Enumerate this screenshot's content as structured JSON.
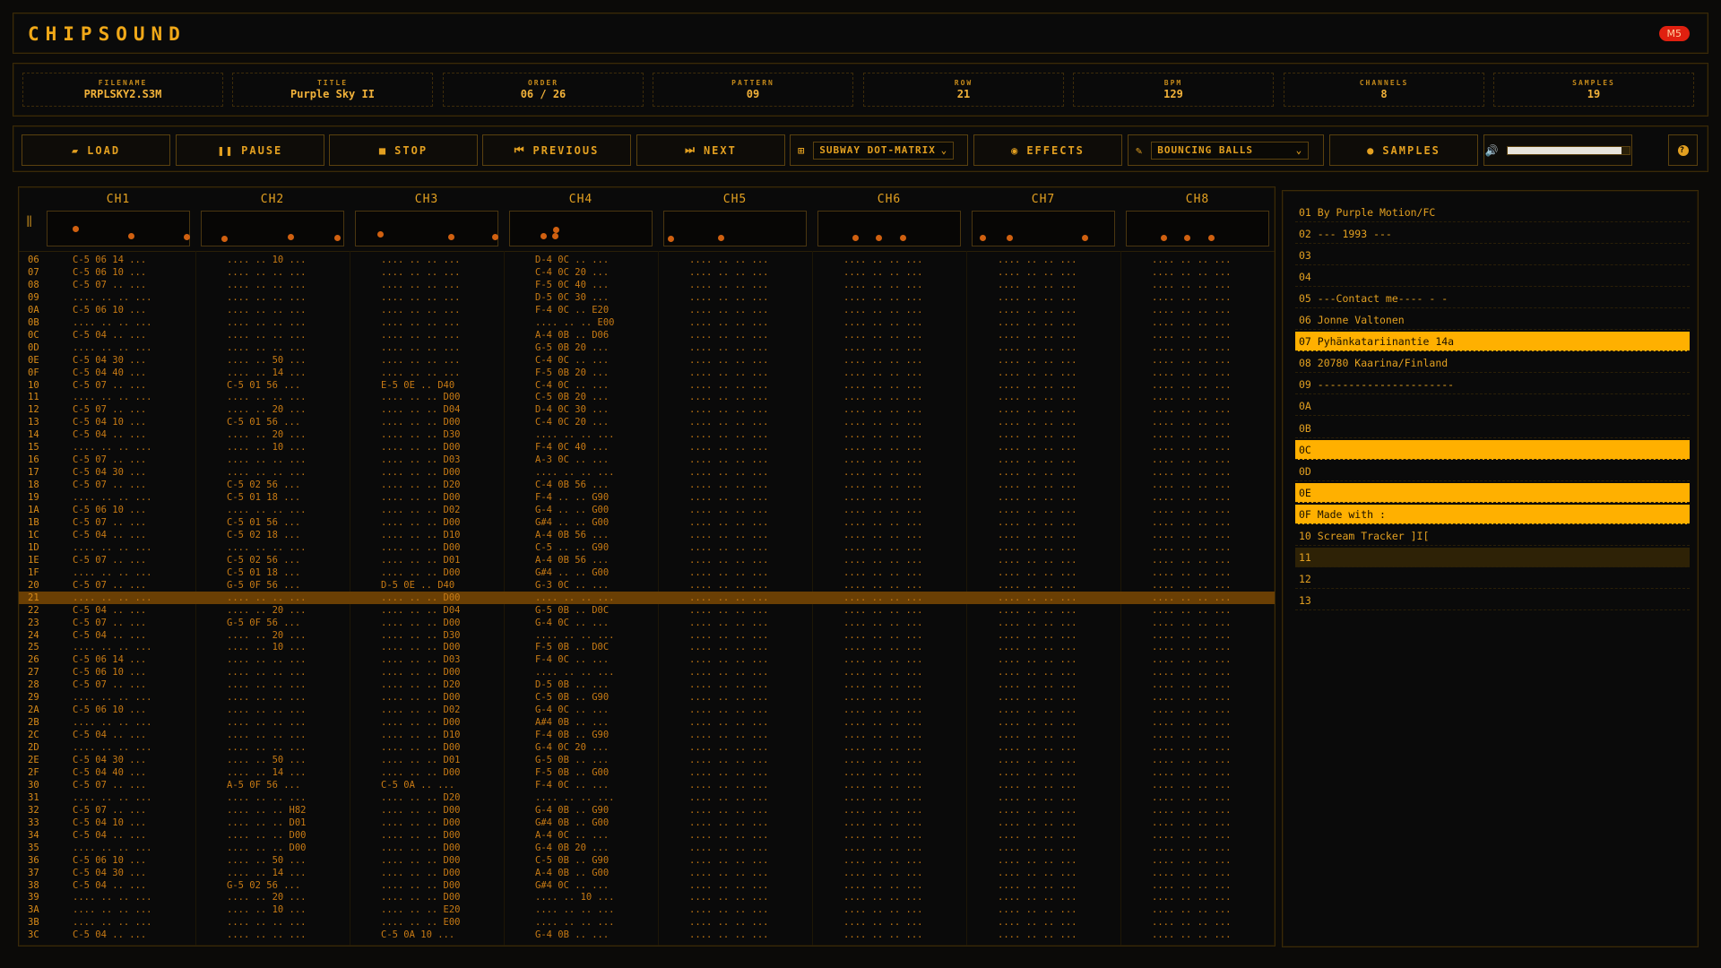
{
  "app": {
    "title": "CHIPSOUND",
    "badge": "M5"
  },
  "info": [
    {
      "label": "FILENAME",
      "value": "PRPLSKY2.S3M"
    },
    {
      "label": "TITLE",
      "value": "Purple Sky II"
    },
    {
      "label": "ORDER",
      "value": "06 / 26"
    },
    {
      "label": "PATTERN",
      "value": "09"
    },
    {
      "label": "ROW",
      "value": "21"
    },
    {
      "label": "BPM",
      "value": "129"
    },
    {
      "label": "CHANNELS",
      "value": "8"
    },
    {
      "label": "SAMPLES",
      "value": "19"
    }
  ],
  "toolbar": {
    "load": "LOAD",
    "pause": "PAUSE",
    "stop": "STOP",
    "previous": "PREVIOUS",
    "next": "NEXT",
    "display_mode": "SUBWAY DOT-MATRIX",
    "effects": "EFFECTS",
    "visualizer": "BOUNCING BALLS",
    "samples": "SAMPLES",
    "volume": 0.93,
    "help": "?"
  },
  "channels": [
    "CH1",
    "CH2",
    "CH3",
    "CH4",
    "CH5",
    "CH6",
    "CH7",
    "CH8"
  ],
  "current_row": "21",
  "rows": [
    [
      "06",
      "C-5 06 14 ...",
      ".... .. 10 ...",
      ".... .. .. ...",
      "D-4 0C .. ...",
      ".... .. .. ...",
      ".... .. .. ...",
      ".... .. .. ...",
      ".... .. .. ..."
    ],
    [
      "07",
      "C-5 06 10 ...",
      ".... .. .. ...",
      ".... .. .. ...",
      "C-4 0C 20 ...",
      ".... .. .. ...",
      ".... .. .. ...",
      ".... .. .. ...",
      ".... .. .. ..."
    ],
    [
      "08",
      "C-5 07 .. ...",
      ".... .. .. ...",
      ".... .. .. ...",
      "F-5 0C 40 ...",
      ".... .. .. ...",
      ".... .. .. ...",
      ".... .. .. ...",
      ".... .. .. ..."
    ],
    [
      "09",
      ".... .. .. ...",
      ".... .. .. ...",
      ".... .. .. ...",
      "D-5 0C 30 ...",
      ".... .. .. ...",
      ".... .. .. ...",
      ".... .. .. ...",
      ".... .. .. ..."
    ],
    [
      "0A",
      "C-5 06 10 ...",
      ".... .. .. ...",
      ".... .. .. ...",
      "F-4 0C .. E20",
      ".... .. .. ...",
      ".... .. .. ...",
      ".... .. .. ...",
      ".... .. .. ..."
    ],
    [
      "0B",
      ".... .. .. ...",
      ".... .. .. ...",
      ".... .. .. ...",
      ".... .. .. E00",
      ".... .. .. ...",
      ".... .. .. ...",
      ".... .. .. ...",
      ".... .. .. ..."
    ],
    [
      "0C",
      "C-5 04 .. ...",
      ".... .. .. ...",
      ".... .. .. ...",
      "A-4 0B .. D06",
      ".... .. .. ...",
      ".... .. .. ...",
      ".... .. .. ...",
      ".... .. .. ..."
    ],
    [
      "0D",
      ".... .. .. ...",
      ".... .. .. ...",
      ".... .. .. ...",
      "G-5 0B 20 ...",
      ".... .. .. ...",
      ".... .. .. ...",
      ".... .. .. ...",
      ".... .. .. ..."
    ],
    [
      "0E",
      "C-5 04 30 ...",
      ".... .. 50 ...",
      ".... .. .. ...",
      "C-4 0C .. ...",
      ".... .. .. ...",
      ".... .. .. ...",
      ".... .. .. ...",
      ".... .. .. ..."
    ],
    [
      "0F",
      "C-5 04 40 ...",
      ".... .. 14 ...",
      ".... .. .. ...",
      "F-5 0B 20 ...",
      ".... .. .. ...",
      ".... .. .. ...",
      ".... .. .. ...",
      ".... .. .. ..."
    ],
    [
      "10",
      "C-5 07 .. ...",
      "C-5 01 56 ...",
      "E-5 0E .. D40",
      "C-4 0C .. ...",
      ".... .. .. ...",
      ".... .. .. ...",
      ".... .. .. ...",
      ".... .. .. ..."
    ],
    [
      "11",
      ".... .. .. ...",
      ".... .. .. ...",
      ".... .. .. D00",
      "C-5 0B 20 ...",
      ".... .. .. ...",
      ".... .. .. ...",
      ".... .. .. ...",
      ".... .. .. ..."
    ],
    [
      "12",
      "C-5 07 .. ...",
      ".... .. 20 ...",
      ".... .. .. D04",
      "D-4 0C 30 ...",
      ".... .. .. ...",
      ".... .. .. ...",
      ".... .. .. ...",
      ".... .. .. ..."
    ],
    [
      "13",
      "C-5 04 10 ...",
      "C-5 01 56 ...",
      ".... .. .. D00",
      "C-4 0C 20 ...",
      ".... .. .. ...",
      ".... .. .. ...",
      ".... .. .. ...",
      ".... .. .. ..."
    ],
    [
      "14",
      "C-5 04 .. ...",
      ".... .. 20 ...",
      ".... .. .. D30",
      ".... .. .. ...",
      ".... .. .. ...",
      ".... .. .. ...",
      ".... .. .. ...",
      ".... .. .. ..."
    ],
    [
      "15",
      ".... .. .. ...",
      ".... .. 10 ...",
      ".... .. .. D00",
      "F-4 0C 40 ...",
      ".... .. .. ...",
      ".... .. .. ...",
      ".... .. .. ...",
      ".... .. .. ..."
    ],
    [
      "16",
      "C-5 07 .. ...",
      ".... .. .. ...",
      ".... .. .. D03",
      "A-3 0C .. ...",
      ".... .. .. ...",
      ".... .. .. ...",
      ".... .. .. ...",
      ".... .. .. ..."
    ],
    [
      "17",
      "C-5 04 30 ...",
      ".... .. .. ...",
      ".... .. .. D00",
      ".... .. .. ...",
      ".... .. .. ...",
      ".... .. .. ...",
      ".... .. .. ...",
      ".... .. .. ..."
    ],
    [
      "18",
      "C-5 07 .. ...",
      "C-5 02 56 ...",
      ".... .. .. D20",
      "C-4 0B 56 ...",
      ".... .. .. ...",
      ".... .. .. ...",
      ".... .. .. ...",
      ".... .. .. ..."
    ],
    [
      "19",
      ".... .. .. ...",
      "C-5 01 18 ...",
      ".... .. .. D00",
      "F-4 .. .. G90",
      ".... .. .. ...",
      ".... .. .. ...",
      ".... .. .. ...",
      ".... .. .. ..."
    ],
    [
      "1A",
      "C-5 06 10 ...",
      ".... .. .. ...",
      ".... .. .. D02",
      "G-4 .. .. G00",
      ".... .. .. ...",
      ".... .. .. ...",
      ".... .. .. ...",
      ".... .. .. ..."
    ],
    [
      "1B",
      "C-5 07 .. ...",
      "C-5 01 56 ...",
      ".... .. .. D00",
      "G#4 .. .. G00",
      ".... .. .. ...",
      ".... .. .. ...",
      ".... .. .. ...",
      ".... .. .. ..."
    ],
    [
      "1C",
      "C-5 04 .. ...",
      "C-5 02 18 ...",
      ".... .. .. D10",
      "A-4 0B 56 ...",
      ".... .. .. ...",
      ".... .. .. ...",
      ".... .. .. ...",
      ".... .. .. ..."
    ],
    [
      "1D",
      ".... .. .. ...",
      ".... .. .. ...",
      ".... .. .. D00",
      "C-5 .. .. G90",
      ".... .. .. ...",
      ".... .. .. ...",
      ".... .. .. ...",
      ".... .. .. ..."
    ],
    [
      "1E",
      "C-5 07 .. ...",
      "C-5 02 56 ...",
      ".... .. .. D01",
      "A-4 0B 56 ...",
      ".... .. .. ...",
      ".... .. .. ...",
      ".... .. .. ...",
      ".... .. .. ..."
    ],
    [
      "1F",
      ".... .. .. ...",
      "C-5 01 18 ...",
      ".... .. .. D00",
      "G#4 .. .. G00",
      ".... .. .. ...",
      ".... .. .. ...",
      ".... .. .. ...",
      ".... .. .. ..."
    ],
    [
      "20",
      "C-5 07 .. ...",
      "G-5 0F 56 ...",
      "D-5 0E .. D40",
      "G-3 0C .. ...",
      ".... .. .. ...",
      ".... .. .. ...",
      ".... .. .. ...",
      ".... .. .. ..."
    ],
    [
      "21",
      ".... .. .. ...",
      ".... .. .. ...",
      ".... .. .. D00",
      ".... .. .. ...",
      ".... .. .. ...",
      ".... .. .. ...",
      ".... .. .. ...",
      ".... .. .. ..."
    ],
    [
      "22",
      "C-5 04 .. ...",
      ".... .. 20 ...",
      ".... .. .. D04",
      "G-5 0B .. D0C",
      ".... .. .. ...",
      ".... .. .. ...",
      ".... .. .. ...",
      ".... .. .. ..."
    ],
    [
      "23",
      "C-5 07 .. ...",
      "G-5 0F 56 ...",
      ".... .. .. D00",
      "G-4 0C .. ...",
      ".... .. .. ...",
      ".... .. .. ...",
      ".... .. .. ...",
      ".... .. .. ..."
    ],
    [
      "24",
      "C-5 04 .. ...",
      ".... .. 20 ...",
      ".... .. .. D30",
      ".... .. .. ...",
      ".... .. .. ...",
      ".... .. .. ...",
      ".... .. .. ...",
      ".... .. .. ..."
    ],
    [
      "25",
      ".... .. .. ...",
      ".... .. 10 ...",
      ".... .. .. D00",
      "F-5 0B .. D0C",
      ".... .. .. ...",
      ".... .. .. ...",
      ".... .. .. ...",
      ".... .. .. ..."
    ],
    [
      "26",
      "C-5 06 14 ...",
      ".... .. .. ...",
      ".... .. .. D03",
      "F-4 0C .. ...",
      ".... .. .. ...",
      ".... .. .. ...",
      ".... .. .. ...",
      ".... .. .. ..."
    ],
    [
      "27",
      "C-5 06 10 ...",
      ".... .. .. ...",
      ".... .. .. D00",
      ".... .. .. ...",
      ".... .. .. ...",
      ".... .. .. ...",
      ".... .. .. ...",
      ".... .. .. ..."
    ],
    [
      "28",
      "C-5 07 .. ...",
      ".... .. .. ...",
      ".... .. .. D20",
      "D-5 0B .. ...",
      ".... .. .. ...",
      ".... .. .. ...",
      ".... .. .. ...",
      ".... .. .. ..."
    ],
    [
      "29",
      ".... .. .. ...",
      ".... .. .. ...",
      ".... .. .. D00",
      "C-5 0B .. G90",
      ".... .. .. ...",
      ".... .. .. ...",
      ".... .. .. ...",
      ".... .. .. ..."
    ],
    [
      "2A",
      "C-5 06 10 ...",
      ".... .. .. ...",
      ".... .. .. D02",
      "G-4 0C .. ...",
      ".... .. .. ...",
      ".... .. .. ...",
      ".... .. .. ...",
      ".... .. .. ..."
    ],
    [
      "2B",
      ".... .. .. ...",
      ".... .. .. ...",
      ".... .. .. D00",
      "A#4 0B .. ...",
      ".... .. .. ...",
      ".... .. .. ...",
      ".... .. .. ...",
      ".... .. .. ..."
    ],
    [
      "2C",
      "C-5 04 .. ...",
      ".... .. .. ...",
      ".... .. .. D10",
      "F-4 0B .. G90",
      ".... .. .. ...",
      ".... .. .. ...",
      ".... .. .. ...",
      ".... .. .. ..."
    ],
    [
      "2D",
      ".... .. .. ...",
      ".... .. .. ...",
      ".... .. .. D00",
      "G-4 0C 20 ...",
      ".... .. .. ...",
      ".... .. .. ...",
      ".... .. .. ...",
      ".... .. .. ..."
    ],
    [
      "2E",
      "C-5 04 30 ...",
      ".... .. 50 ...",
      ".... .. .. D01",
      "G-5 0B .. ...",
      ".... .. .. ...",
      ".... .. .. ...",
      ".... .. .. ...",
      ".... .. .. ..."
    ],
    [
      "2F",
      "C-5 04 40 ...",
      ".... .. 14 ...",
      ".... .. .. D00",
      "F-5 0B .. G00",
      ".... .. .. ...",
      ".... .. .. ...",
      ".... .. .. ...",
      ".... .. .. ..."
    ],
    [
      "30",
      "C-5 07 .. ...",
      "A-5 0F 56 ...",
      "C-5 0A .. ...",
      "F-4 0C .. ...",
      ".... .. .. ...",
      ".... .. .. ...",
      ".... .. .. ...",
      ".... .. .. ..."
    ],
    [
      "31",
      ".... .. .. ...",
      ".... .. .. ...",
      ".... .. .. D20",
      ".... .. .. ...",
      ".... .. .. ...",
      ".... .. .. ...",
      ".... .. .. ...",
      ".... .. .. ..."
    ],
    [
      "32",
      "C-5 07 .. ...",
      ".... .. .. H82",
      ".... .. .. D00",
      "G-4 0B .. G90",
      ".... .. .. ...",
      ".... .. .. ...",
      ".... .. .. ...",
      ".... .. .. ..."
    ],
    [
      "33",
      "C-5 04 10 ...",
      ".... .. .. D01",
      ".... .. .. D00",
      "G#4 0B .. G00",
      ".... .. .. ...",
      ".... .. .. ...",
      ".... .. .. ...",
      ".... .. .. ..."
    ],
    [
      "34",
      "C-5 04 .. ...",
      ".... .. .. D00",
      ".... .. .. D00",
      "A-4 0C .. ...",
      ".... .. .. ...",
      ".... .. .. ...",
      ".... .. .. ...",
      ".... .. .. ..."
    ],
    [
      "35",
      ".... .. .. ...",
      ".... .. .. D00",
      ".... .. .. D00",
      "G-4 0B 20 ...",
      ".... .. .. ...",
      ".... .. .. ...",
      ".... .. .. ...",
      ".... .. .. ..."
    ],
    [
      "36",
      "C-5 06 10 ...",
      ".... .. 50 ...",
      ".... .. .. D00",
      "C-5 0B .. G90",
      ".... .. .. ...",
      ".... .. .. ...",
      ".... .. .. ...",
      ".... .. .. ..."
    ],
    [
      "37",
      "C-5 04 30 ...",
      ".... .. 14 ...",
      ".... .. .. D00",
      "A-4 0B .. G00",
      ".... .. .. ...",
      ".... .. .. ...",
      ".... .. .. ...",
      ".... .. .. ..."
    ],
    [
      "38",
      "C-5 04 .. ...",
      "G-5 02 56 ...",
      ".... .. .. D00",
      "G#4 0C .. ...",
      ".... .. .. ...",
      ".... .. .. ...",
      ".... .. .. ...",
      ".... .. .. ..."
    ],
    [
      "39",
      ".... .. .. ...",
      ".... .. 20 ...",
      ".... .. .. D00",
      ".... .. 10 ...",
      ".... .. .. ...",
      ".... .. .. ...",
      ".... .. .. ...",
      ".... .. .. ..."
    ],
    [
      "3A",
      ".... .. .. ...",
      ".... .. 10 ...",
      ".... .. .. E20",
      ".... .. .. ...",
      ".... .. .. ...",
      ".... .. .. ...",
      ".... .. .. ...",
      ".... .. .. ..."
    ],
    [
      "3B",
      ".... .. .. ...",
      ".... .. .. ...",
      ".... .. .. E00",
      ".... .. .. ...",
      ".... .. .. ...",
      ".... .. .. ...",
      ".... .. .. ...",
      ".... .. .. ..."
    ],
    [
      "3C",
      "C-5 04 .. ...",
      ".... .. .. ...",
      "C-5 0A 10 ...",
      "G-4 0B .. ...",
      ".... .. .. ...",
      ".... .. .. ...",
      ".... .. .. ...",
      ".... .. .. ..."
    ]
  ],
  "sample_list": [
    {
      "text": "01 By Purple Motion/FC",
      "state": ""
    },
    {
      "text": "02 --- 1993 ---",
      "state": ""
    },
    {
      "text": "03",
      "state": ""
    },
    {
      "text": "04",
      "state": ""
    },
    {
      "text": "05 ---Contact me---- - -",
      "state": ""
    },
    {
      "text": "06 Jonne Valtonen",
      "state": ""
    },
    {
      "text": "07 Pyhänkatariinantie 14a",
      "state": "hl"
    },
    {
      "text": "08 20780 Kaarina/Finland",
      "state": ""
    },
    {
      "text": "09 ----------------------",
      "state": ""
    },
    {
      "text": "0A",
      "state": ""
    },
    {
      "text": "0B",
      "state": ""
    },
    {
      "text": "0C",
      "state": "hl"
    },
    {
      "text": "0D",
      "state": ""
    },
    {
      "text": "0E",
      "state": "hl"
    },
    {
      "text": "0F Made with :",
      "state": "hl"
    },
    {
      "text": "10 Scream Tracker ]I[",
      "state": ""
    },
    {
      "text": "11",
      "state": "dim"
    },
    {
      "text": "12",
      "state": ""
    },
    {
      "text": "13",
      "state": ""
    }
  ],
  "colors": {
    "accent": "#ffb000",
    "background": "#0a0a0a",
    "current_row": "#6a3f04"
  }
}
